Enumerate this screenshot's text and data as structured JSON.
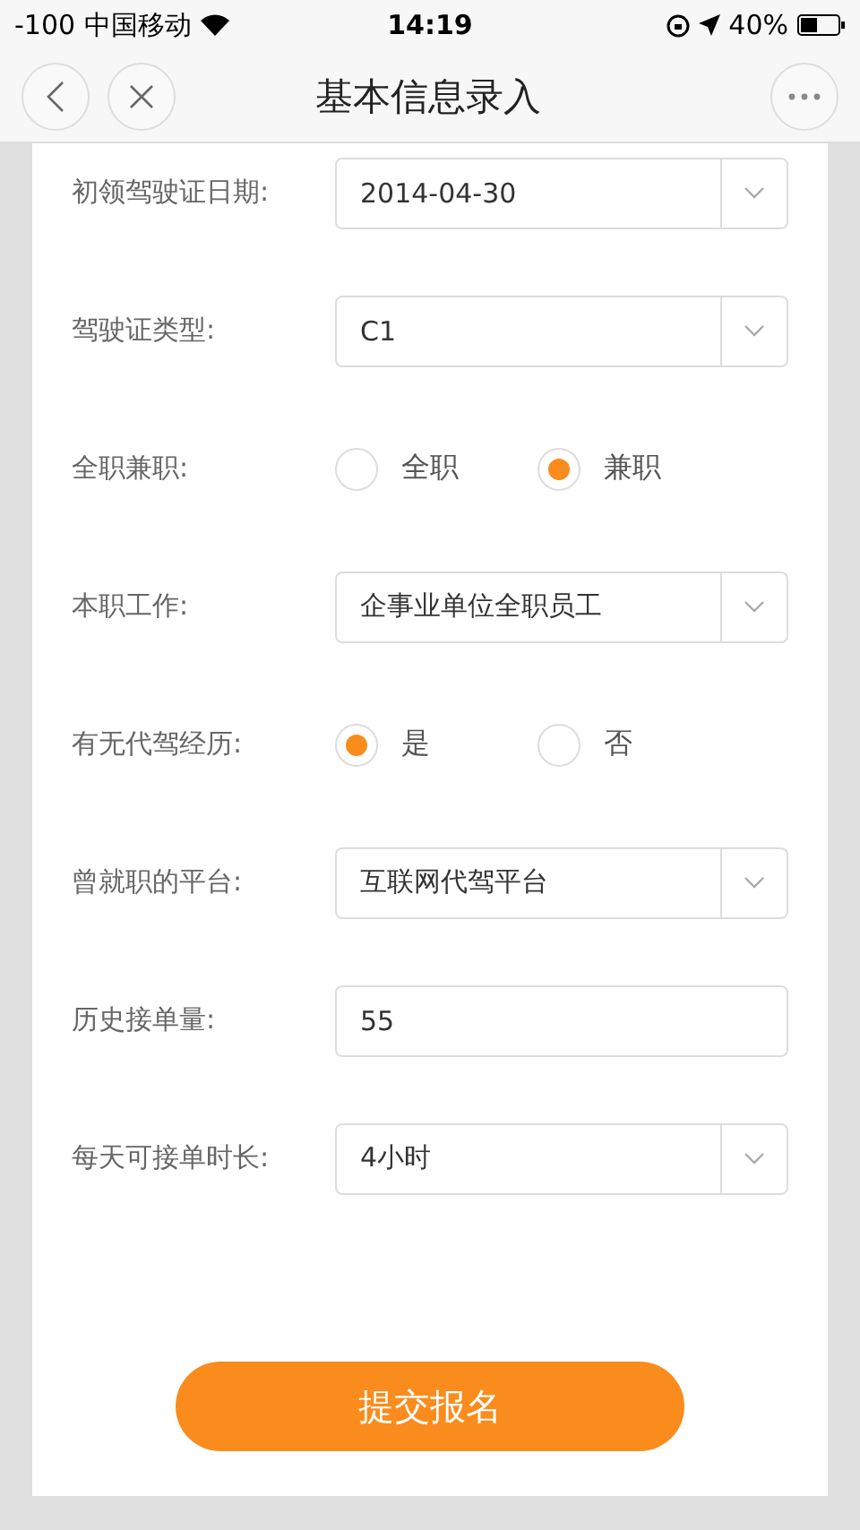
{
  "status_bar": {
    "signal": "-100",
    "carrier": "中国移动",
    "time": "14:19",
    "battery": "40%"
  },
  "nav_bar": {
    "title": "基本信息录入"
  },
  "form": {
    "fields": [
      {
        "kind": "select",
        "label": "初领驾驶证日期:",
        "value": "2014-04-30"
      },
      {
        "kind": "select",
        "label": "驾驶证类型:",
        "value": "C1"
      },
      {
        "kind": "radio",
        "label": "全职兼职:",
        "options": [
          {
            "label": "全职",
            "selected": false
          },
          {
            "label": "兼职",
            "selected": true
          }
        ]
      },
      {
        "kind": "select",
        "label": "本职工作:",
        "value": "企事业单位全职员工"
      },
      {
        "kind": "radio",
        "label": "有无代驾经历:",
        "options": [
          {
            "label": "是",
            "selected": true
          },
          {
            "label": "否",
            "selected": false
          }
        ]
      },
      {
        "kind": "select",
        "label": "曾就职的平台:",
        "value": "互联网代驾平台"
      },
      {
        "kind": "input",
        "label": "历史接单量:",
        "value": "55"
      },
      {
        "kind": "select",
        "label": "每天可接单时长:",
        "value": "4小时"
      }
    ],
    "submit": "提交报名"
  }
}
